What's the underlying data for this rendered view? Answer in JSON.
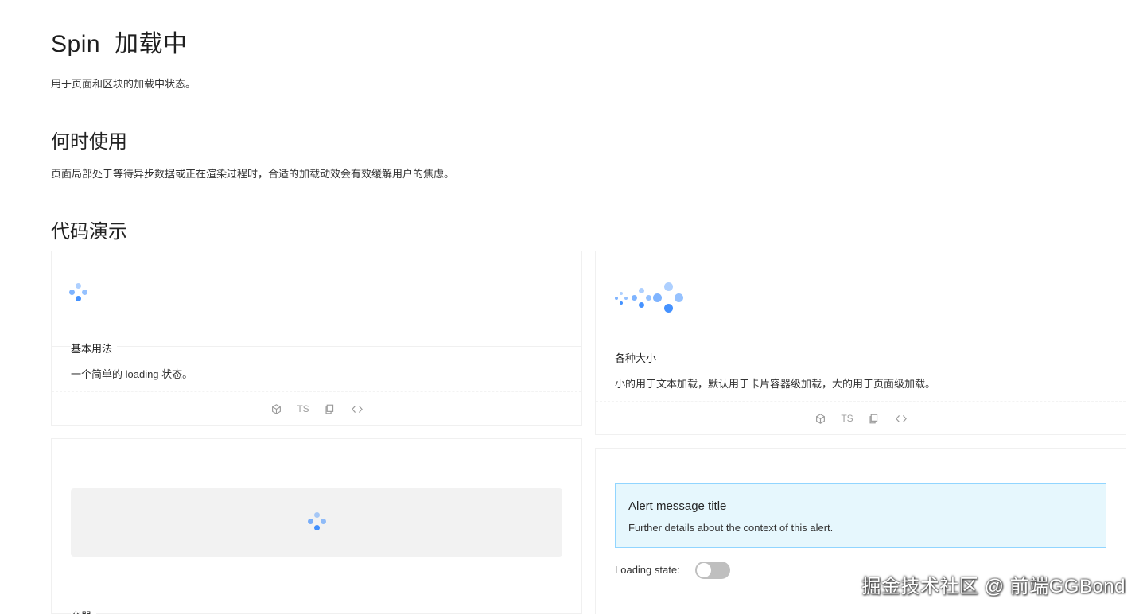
{
  "header": {
    "title": "Spin",
    "title_cn": "加载中",
    "intro": "用于页面和区块的加载中状态。"
  },
  "when_to_use": {
    "heading": "何时使用",
    "text": "页面局部处于等待异步数据或正在渲染过程时，合适的加载动效会有效缓解用户的焦虑。"
  },
  "demos": {
    "heading": "代码演示",
    "basic": {
      "title": "基本用法",
      "description": "一个简单的 loading 状态。"
    },
    "sizes": {
      "title": "各种大小",
      "description": "小的用于文本加载，默认用于卡片容器级加载，大的用于页面级加载。"
    },
    "container": {
      "title": "容器"
    },
    "alert_demo": {
      "alert_title": "Alert message title",
      "alert_description": "Further details about the context of this alert.",
      "switch_label": "Loading state:",
      "switch_on": false
    },
    "actions": {
      "ts_label": "TS",
      "icons": [
        "codesandbox-icon",
        "ts-label",
        "copy-icon",
        "code-expand-icon"
      ]
    }
  },
  "colors": {
    "spin": "#1677ff",
    "alert_bg": "#e6f7fd",
    "alert_border": "#91d5ff",
    "switch_off": "#bfbfbf"
  },
  "watermark": "掘金技术社区 @ 前端GGBond"
}
